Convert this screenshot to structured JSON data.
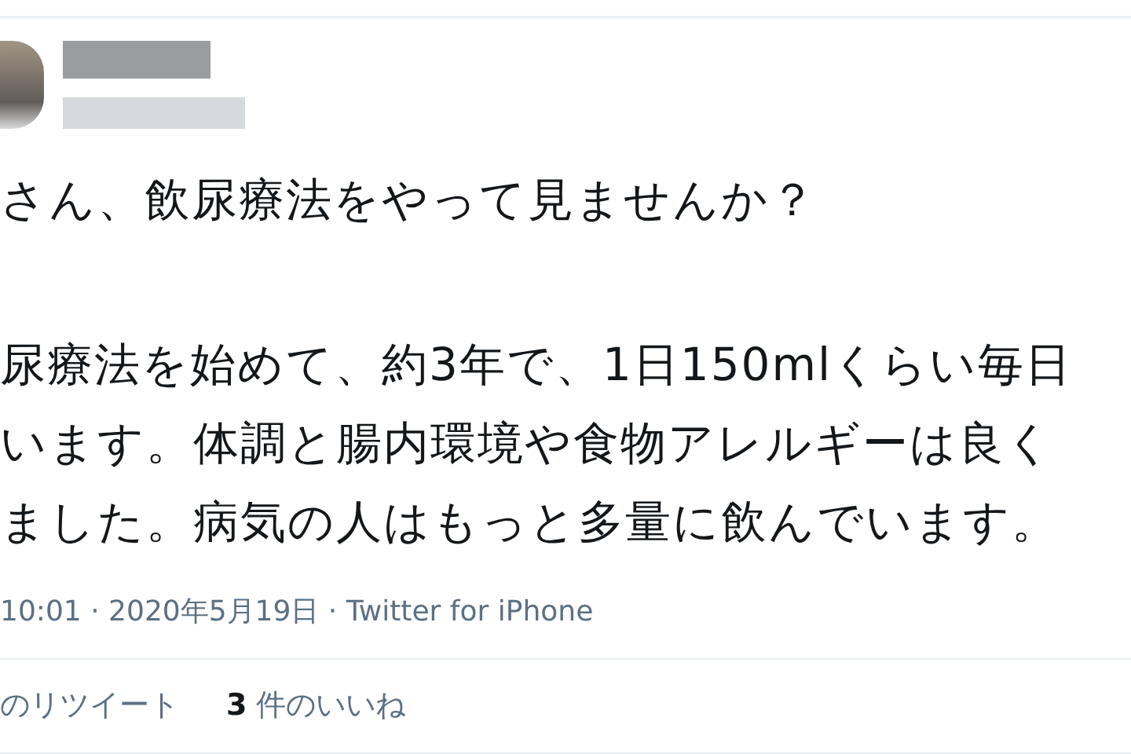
{
  "tweet": {
    "paragraphs": [
      [
        "さん、飲尿療法をやって見ませんか？"
      ],
      [
        "尿療法を始めて、約3年で、1日150mlくらい毎日",
        "います。体調と腸内環境や食物アレルギーは良く",
        "ました。病気の人はもっと多量に飲んでいます。"
      ]
    ],
    "meta": "10:01 · 2020年5月19日 · Twitter for iPhone",
    "stats": [
      {
        "label": "のリツイート"
      },
      {
        "count": "3",
        "label": "件のいいね"
      }
    ]
  }
}
